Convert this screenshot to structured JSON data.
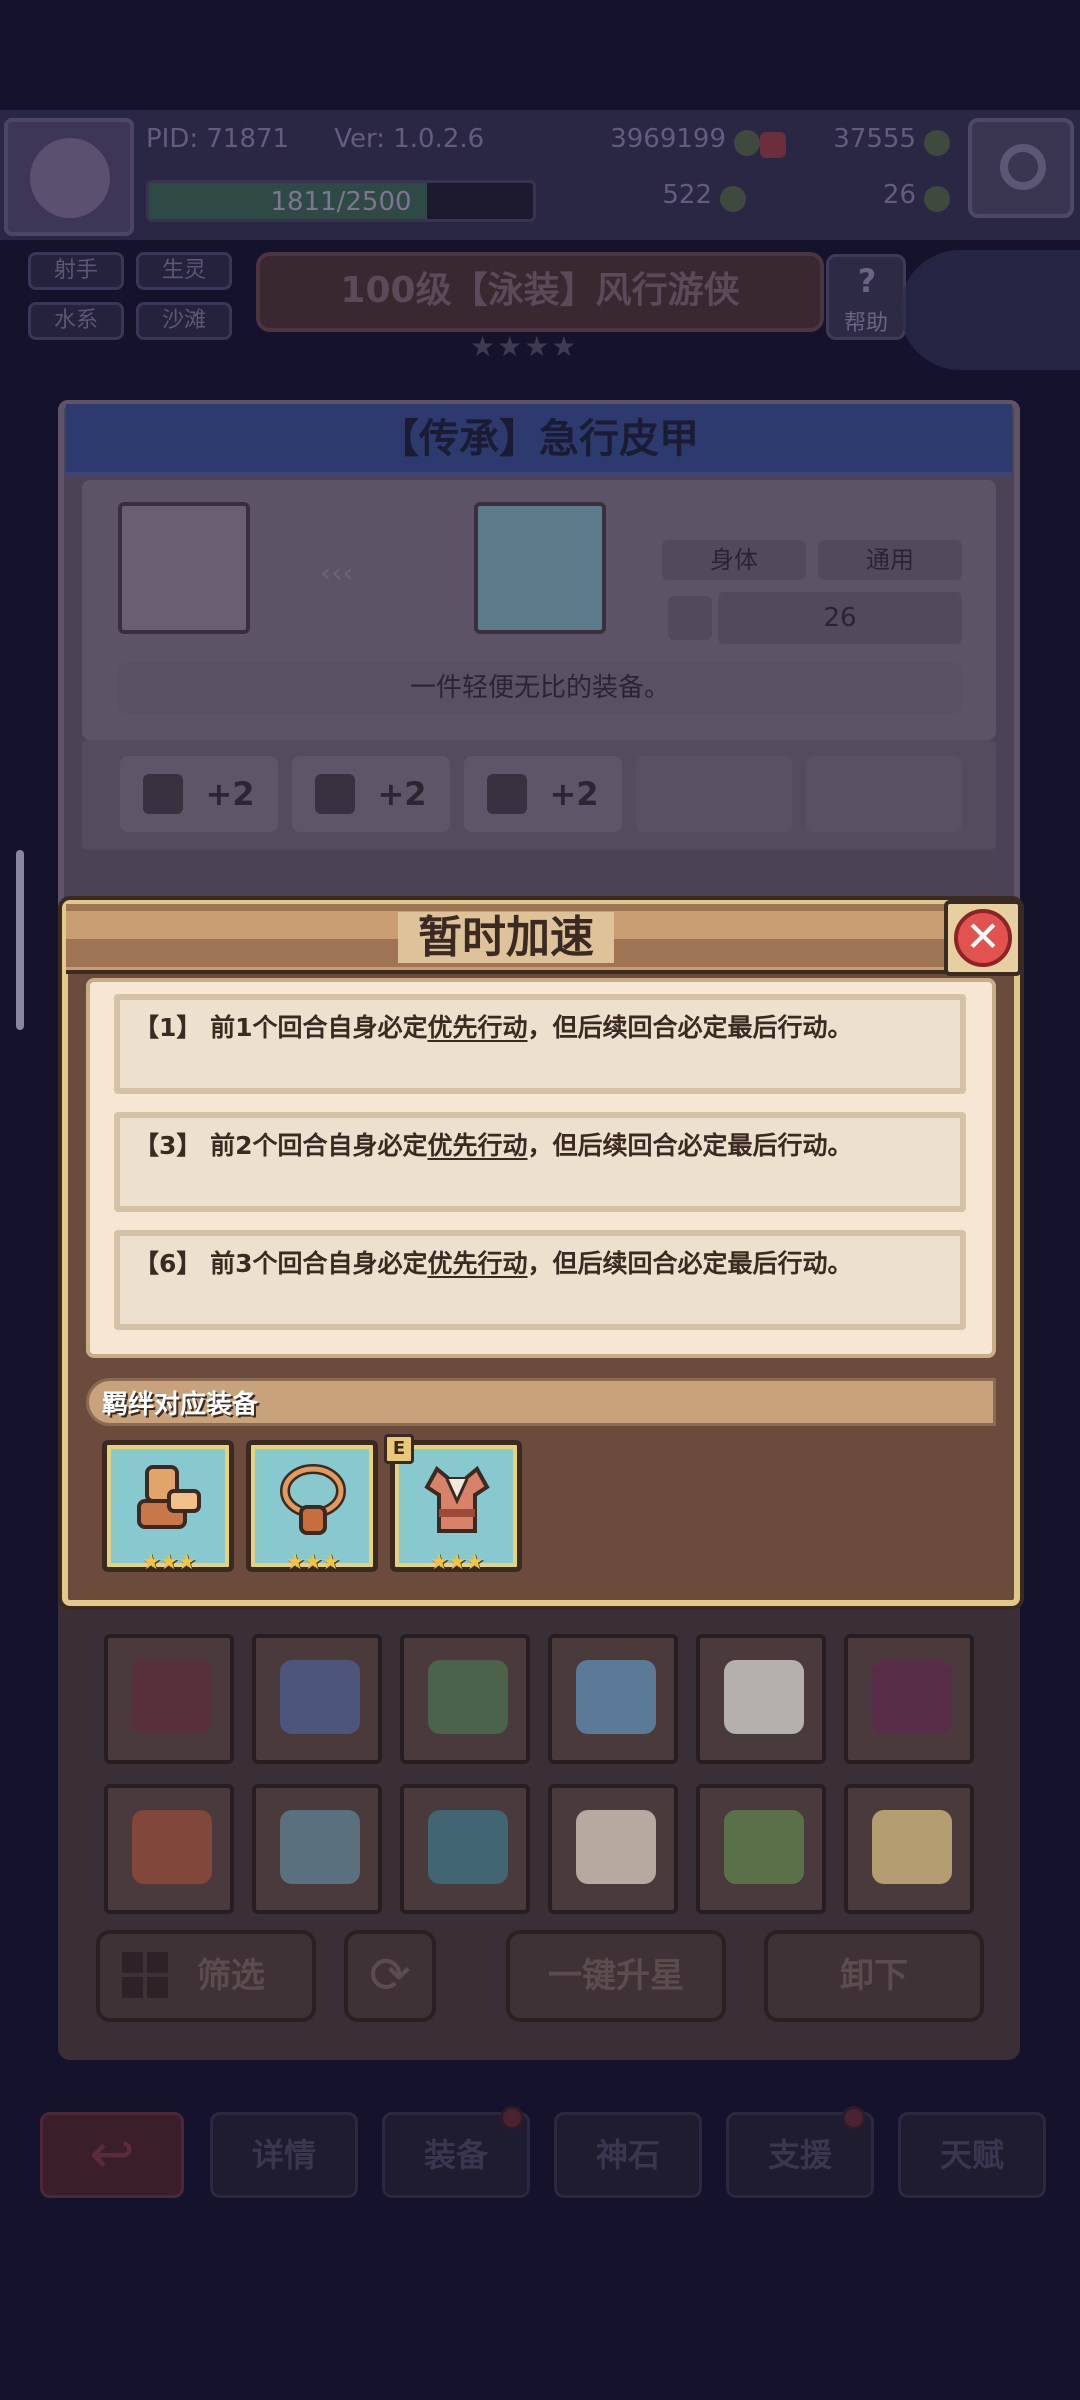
{
  "topbar": {
    "pid": "PID: 71871",
    "version": "Ver: 1.0.2.6",
    "gold": "3969199",
    "gems": "37555",
    "xp": "1811/2500",
    "xp_fraction": 0.7244,
    "res_a": "522",
    "res_b": "26"
  },
  "character": {
    "tags": [
      "射手",
      "生灵",
      "水系",
      "沙滩"
    ],
    "name": "100级【泳装】风行游侠",
    "stars": "★★★★",
    "help_label": "帮助"
  },
  "equipment": {
    "title": "【传承】急行皮甲",
    "slot": "身体",
    "scope": "通用",
    "level": "26",
    "description": "一件轻便无比的装备。",
    "bonuses": [
      {
        "icon": "boot-icon",
        "value": "+2"
      },
      {
        "icon": "stone-icon",
        "value": "+2"
      },
      {
        "icon": "shield-icon",
        "value": "+2"
      }
    ]
  },
  "inventory_colors": [
    [
      "#5b2f3a",
      "#4d5b88",
      "#4e6a4c",
      "#5d86a8",
      "#c9c6c0",
      "#5a2b4a"
    ],
    [
      "#8b4a3a",
      "#5d7a8a",
      "#3f6f7a",
      "#c9bdb0",
      "#5d7a4a",
      "#c7b07a"
    ]
  ],
  "buttons": {
    "filter": "筛选",
    "upgrade_all": "一键升星",
    "unequip": "卸下"
  },
  "nav": {
    "tabs": [
      "详情",
      "装备",
      "神石",
      "支援",
      "天赋"
    ]
  },
  "popup": {
    "title": "暂时加速",
    "close_label": "✕",
    "effects": [
      {
        "prefix": "【1】 前1个回合自身必定",
        "keyword": "优先行动",
        "suffix": "，但后续回合必定最后行动。"
      },
      {
        "prefix": "【3】 前2个回合自身必定",
        "keyword": "优先行动",
        "suffix": "，但后续回合必定最后行动。"
      },
      {
        "prefix": "【6】 前3个回合自身必定",
        "keyword": "优先行动",
        "suffix": "，但后续回合必定最后行动。"
      }
    ],
    "bond_label": "羁绊对应装备",
    "bond_items": [
      {
        "name": "boots",
        "stars": "★★★"
      },
      {
        "name": "amulet",
        "stars": "★★★"
      },
      {
        "name": "armor",
        "stars": "★★★",
        "badge": "E"
      }
    ]
  },
  "colors": {
    "accent_gold": "#e0c98a",
    "close_red": "#e2534f",
    "panel_cream": "#f5e7d3",
    "frame_brown": "#6b4b3c"
  }
}
